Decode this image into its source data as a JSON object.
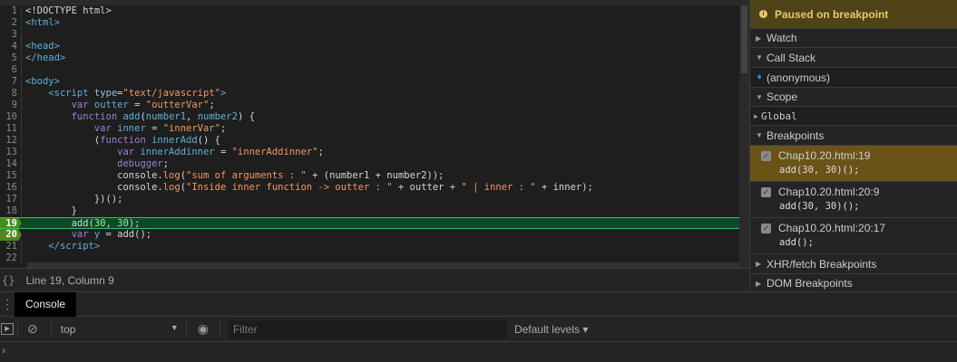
{
  "editor": {
    "lines": [
      {
        "n": "1",
        "tokens": [
          [
            "plain",
            "<!DOCTYPE html>"
          ]
        ]
      },
      {
        "n": "2",
        "tokens": [
          [
            "tag",
            "<html>"
          ]
        ]
      },
      {
        "n": "3",
        "tokens": []
      },
      {
        "n": "4",
        "tokens": [
          [
            "tag",
            "<head>"
          ]
        ]
      },
      {
        "n": "5",
        "tokens": [
          [
            "tag",
            "</head>"
          ]
        ]
      },
      {
        "n": "6",
        "tokens": []
      },
      {
        "n": "7",
        "tokens": [
          [
            "tag",
            "<body>"
          ]
        ]
      },
      {
        "n": "8",
        "tokens": [
          [
            "plain",
            "    "
          ],
          [
            "tag",
            "<script "
          ],
          [
            "attr",
            "type"
          ],
          [
            "plain",
            "="
          ],
          [
            "str",
            "\"text/javascript\""
          ],
          [
            "tag",
            ">"
          ]
        ]
      },
      {
        "n": "9",
        "tokens": [
          [
            "plain",
            "        "
          ],
          [
            "kw",
            "var "
          ],
          [
            "var",
            "outter"
          ],
          [
            "plain",
            " = "
          ],
          [
            "str",
            "\"outterVar\""
          ],
          [
            "plain",
            ";"
          ]
        ]
      },
      {
        "n": "10",
        "tokens": [
          [
            "plain",
            "        "
          ],
          [
            "kw",
            "function "
          ],
          [
            "fn",
            "add"
          ],
          [
            "plain",
            "("
          ],
          [
            "var",
            "number1"
          ],
          [
            "plain",
            ", "
          ],
          [
            "var",
            "number2"
          ],
          [
            "plain",
            ") {"
          ]
        ]
      },
      {
        "n": "11",
        "tokens": [
          [
            "plain",
            "            "
          ],
          [
            "kw",
            "var "
          ],
          [
            "var",
            "inner"
          ],
          [
            "plain",
            " = "
          ],
          [
            "str",
            "\"innerVar\""
          ],
          [
            "plain",
            ";"
          ]
        ]
      },
      {
        "n": "12",
        "tokens": [
          [
            "plain",
            "            ("
          ],
          [
            "kw",
            "function "
          ],
          [
            "fn",
            "innerAdd"
          ],
          [
            "plain",
            "() {"
          ]
        ]
      },
      {
        "n": "13",
        "tokens": [
          [
            "plain",
            "                "
          ],
          [
            "kw",
            "var "
          ],
          [
            "var",
            "innerAddinner"
          ],
          [
            "plain",
            " = "
          ],
          [
            "str",
            "\"innerAddinner\""
          ],
          [
            "plain",
            ";"
          ]
        ]
      },
      {
        "n": "14",
        "tokens": [
          [
            "plain",
            "                "
          ],
          [
            "kw",
            "debugger"
          ],
          [
            "plain",
            ";"
          ]
        ]
      },
      {
        "n": "15",
        "tokens": [
          [
            "plain",
            "                console."
          ],
          [
            "str",
            "log"
          ],
          [
            "plain",
            "("
          ],
          [
            "str",
            "\"sum of arguments : \""
          ],
          [
            "plain",
            " + (number1 + number2));"
          ]
        ]
      },
      {
        "n": "16",
        "tokens": [
          [
            "plain",
            "                console."
          ],
          [
            "str",
            "log"
          ],
          [
            "plain",
            "("
          ],
          [
            "str",
            "\"Inside inner function -> outter : \""
          ],
          [
            "plain",
            " + outter + "
          ],
          [
            "str",
            "\" | inner : \""
          ],
          [
            "plain",
            " + inner);"
          ]
        ]
      },
      {
        "n": "17",
        "tokens": [
          [
            "plain",
            "            })();"
          ]
        ]
      },
      {
        "n": "18",
        "tokens": [
          [
            "plain",
            "        }"
          ]
        ]
      },
      {
        "n": "19",
        "tokens": [
          [
            "plain",
            "        add("
          ],
          [
            "num",
            "30"
          ],
          [
            "plain",
            ", "
          ],
          [
            "num",
            "30"
          ],
          [
            "plain",
            ");"
          ]
        ],
        "exec": true,
        "bp": true
      },
      {
        "n": "20",
        "tokens": [
          [
            "plain",
            "        "
          ],
          [
            "kw",
            "var "
          ],
          [
            "var",
            "y"
          ],
          [
            "plain",
            " = add();"
          ]
        ],
        "bp": true
      },
      {
        "n": "21",
        "tokens": [
          [
            "plain",
            "    "
          ],
          [
            "tag",
            "</script>"
          ]
        ]
      },
      {
        "n": "22",
        "tokens": []
      }
    ]
  },
  "status": {
    "braces": "{}",
    "position": "Line 19, Column 9"
  },
  "sidebar": {
    "paused": "Paused on breakpoint",
    "watch": "Watch",
    "call_stack": "Call Stack",
    "frame": "(anonymous)",
    "scope": "Scope",
    "global": "Global",
    "breakpoints": "Breakpoints",
    "bp_items": [
      {
        "file": "Chap10.20.html:19",
        "code": "add(30, 30)();"
      },
      {
        "file": "Chap10.20.html:20:9",
        "code": "add(30, 30)();"
      },
      {
        "file": "Chap10.20.html:20:17",
        "code": "add();"
      }
    ],
    "xhr": "XHR/fetch Breakpoints",
    "dom": "DOM Breakpoints"
  },
  "drawer": {
    "tab": "Console",
    "context": "top",
    "filter_placeholder": "Filter",
    "levels": "Default levels ▾",
    "prompt": "›"
  }
}
